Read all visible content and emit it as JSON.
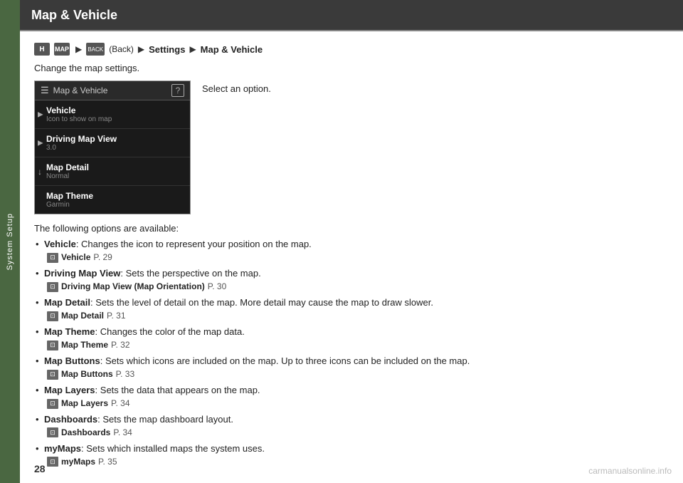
{
  "sidebar": {
    "label": "System Setup"
  },
  "header": {
    "title": "Map & Vehicle"
  },
  "nav": {
    "home_icon": "H",
    "map_icon": "MAP",
    "back_icon": "BACK",
    "back_label": "(Back)",
    "arrow": "▶",
    "settings": "Settings",
    "section": "Map & Vehicle"
  },
  "intro": "Change the map settings.",
  "select_option": "Select an option.",
  "menu": {
    "header_title": "Map & Vehicle",
    "help": "?",
    "items": [
      {
        "title": "Vehicle",
        "subtitle": "Icon to show on map",
        "arrow": "▶"
      },
      {
        "title": "Driving Map View",
        "subtitle": "3.0",
        "arrow": "▶"
      },
      {
        "title": "Map Detail",
        "subtitle": "Normal",
        "arrow": "↓"
      },
      {
        "title": "Map Theme",
        "subtitle": "Garmin",
        "arrow": ""
      }
    ]
  },
  "options_header": "The following options are available:",
  "options": [
    {
      "title": "Vehicle",
      "desc": ": Changes the icon to represent your position on the map.",
      "ref_text": "Vehicle",
      "ref_page": "P. 29"
    },
    {
      "title": "Driving Map View",
      "desc": ": Sets the perspective on the map.",
      "ref_text": "Driving Map View (Map Orientation)",
      "ref_page": "P. 30"
    },
    {
      "title": "Map Detail",
      "desc": ": Sets the level of detail on the map. More detail may cause the map to draw slower.",
      "ref_text": "Map Detail",
      "ref_page": "P. 31"
    },
    {
      "title": "Map Theme",
      "desc": ": Changes the color of the map data.",
      "ref_text": "Map Theme",
      "ref_page": "P. 32"
    },
    {
      "title": "Map Buttons",
      "desc": ": Sets which icons are included on the map. Up to three icons can be included on the map.",
      "ref_text": "Map Buttons",
      "ref_page": "P. 33"
    },
    {
      "title": "Map Layers",
      "desc": ": Sets the data that appears on the map.",
      "ref_text": "Map Layers",
      "ref_page": "P. 34"
    },
    {
      "title": "Dashboards",
      "desc": ": Sets the map dashboard layout.",
      "ref_text": "Dashboards",
      "ref_page": "P. 34"
    },
    {
      "title": "myMaps",
      "desc": ": Sets which installed maps the system uses.",
      "ref_text": "myMaps",
      "ref_page": "P. 35"
    }
  ],
  "page_number": "28",
  "watermark": "carmanualsonline.info"
}
